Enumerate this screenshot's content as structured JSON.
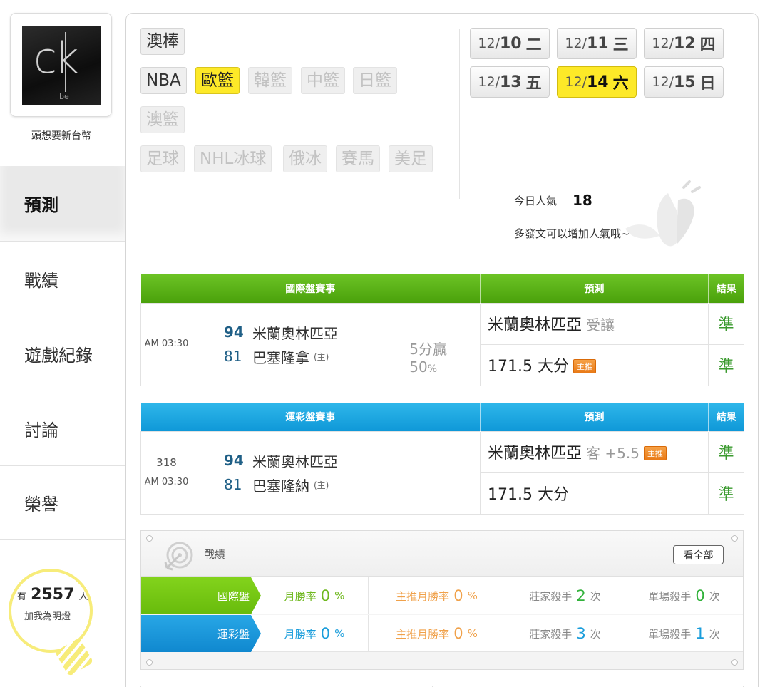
{
  "user": {
    "name": "頭想要新台幣",
    "avatar_text": "ck",
    "avatar_sub": "be"
  },
  "nav": [
    {
      "label": "預測",
      "active": true
    },
    {
      "label": "戰績",
      "active": false
    },
    {
      "label": "遊戲紀錄",
      "active": false
    },
    {
      "label": "討論",
      "active": false
    },
    {
      "label": "榮譽",
      "active": false
    }
  ],
  "fans": {
    "prefix": "有",
    "count": "2557",
    "suffix": "人",
    "label": "加我為明燈"
  },
  "sports": [
    {
      "label": "澳棒",
      "state": "enabled"
    },
    {
      "label": "NBA",
      "state": "enabled"
    },
    {
      "label": "歐籃",
      "state": "selected"
    },
    {
      "label": "韓籃",
      "state": "disabled"
    },
    {
      "label": "中籃",
      "state": "disabled"
    },
    {
      "label": "日籃",
      "state": "disabled"
    },
    {
      "label": "澳籃",
      "state": "disabled"
    },
    {
      "label": "足球",
      "state": "disabled"
    },
    {
      "label": "NHL冰球",
      "state": "disabled"
    },
    {
      "label": "俄冰",
      "state": "disabled"
    },
    {
      "label": "賽馬",
      "state": "disabled"
    },
    {
      "label": "美足",
      "state": "disabled"
    }
  ],
  "dates": [
    {
      "month": "12/",
      "day": "10",
      "weekday": "二",
      "selected": false
    },
    {
      "month": "12/",
      "day": "11",
      "weekday": "三",
      "selected": false
    },
    {
      "month": "12/",
      "day": "12",
      "weekday": "四",
      "selected": false
    },
    {
      "month": "12/",
      "day": "13",
      "weekday": "五",
      "selected": false
    },
    {
      "month": "12/",
      "day": "14",
      "weekday": "六",
      "selected": true
    },
    {
      "month": "12/",
      "day": "15",
      "weekday": "日",
      "selected": false
    }
  ],
  "popularity": {
    "label": "今日人氣",
    "value": "18",
    "hint": "多發文可以增加人氣哦~"
  },
  "intl_table": {
    "headers": [
      "國際盤賽事",
      "預測",
      "結果"
    ],
    "time": "AM 03:30",
    "teams": [
      {
        "score": "94",
        "name": "米蘭奧林匹亞",
        "home": ""
      },
      {
        "score": "81",
        "name": "巴塞隆拿",
        "home": "(主)"
      }
    ],
    "spread": "5分贏",
    "spread_pct": "50",
    "spread_pct_unit": "%",
    "predictions": [
      {
        "pick": "米蘭奧林匹亞",
        "detail": "受讓",
        "badge": "",
        "result": "準"
      },
      {
        "pick": "171.5 大分",
        "detail": "",
        "badge": "主推",
        "result": "準"
      }
    ]
  },
  "lottery_table": {
    "headers": [
      "運彩盤賽事",
      "預測",
      "結果"
    ],
    "code": "318",
    "time": "AM 03:30",
    "teams": [
      {
        "score": "94",
        "name": "米蘭奧林匹亞",
        "home": ""
      },
      {
        "score": "81",
        "name": "巴塞隆納",
        "home": "(主)"
      }
    ],
    "predictions": [
      {
        "pick": "米蘭奧林匹亞",
        "detail": "客 +5.5",
        "badge": "主推",
        "result": "準"
      },
      {
        "pick": "171.5 大分",
        "detail": "",
        "badge": "",
        "result": "準"
      }
    ]
  },
  "stats": {
    "title": "戰績",
    "view_all": "看全部",
    "rows": [
      {
        "name": "國際盤",
        "month_label": "月勝率",
        "month_value": "0",
        "month_unit": "%",
        "main_label": "主推月勝率",
        "main_value": "0",
        "main_unit": "%",
        "house_label": "莊家殺手",
        "house_value": "2",
        "house_unit": "次",
        "single_label": "單場殺手",
        "single_value": "0",
        "single_unit": "次"
      },
      {
        "name": "運彩盤",
        "month_label": "月勝率",
        "month_value": "0",
        "month_unit": "%",
        "main_label": "主推月勝率",
        "main_value": "0",
        "main_unit": "%",
        "house_label": "莊家殺手",
        "house_value": "3",
        "house_unit": "次",
        "single_label": "單場殺手",
        "single_value": "1",
        "single_unit": "次"
      }
    ]
  },
  "colors": {
    "selected_yellow": "#fde928",
    "intl_green": "#5ab216",
    "lottery_blue": "#1aa6e2",
    "result_green": "#3a9a2e"
  }
}
